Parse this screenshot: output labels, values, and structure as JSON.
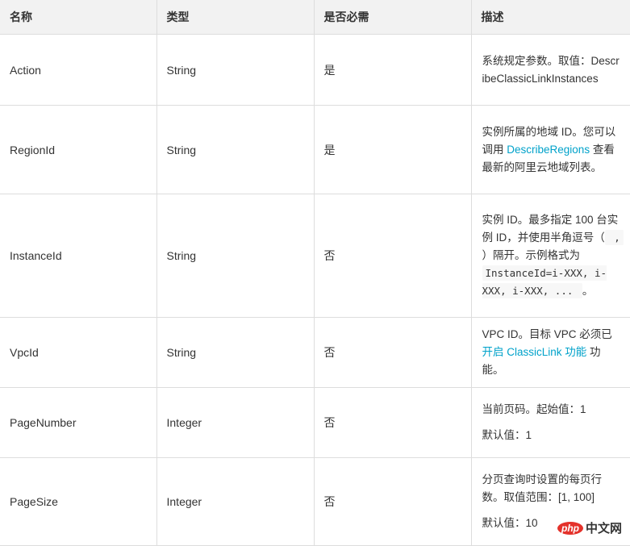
{
  "table": {
    "headers": [
      "名称",
      "类型",
      "是否必需",
      "描述"
    ],
    "rows": [
      {
        "name": "Action",
        "type": "String",
        "required": "是",
        "desc": {
          "text1": "系统规定参数。取值：DescribeClassicLinkInstances"
        }
      },
      {
        "name": "RegionId",
        "type": "String",
        "required": "是",
        "desc": {
          "before": "实例所属的地域 ID。您可以调用 ",
          "link": "DescribeRegions",
          "after": " 查看最新的阿里云地域列表。"
        }
      },
      {
        "name": "InstanceId",
        "type": "String",
        "required": "否",
        "desc": {
          "part1": "实例 ID。最多指定 100 台实例 ID，并使用半角逗号（",
          "code1": " , ",
          "part2": "）隔开。示例格式为 ",
          "code2": " InstanceId=i-XXX, i-XXX, i-XXX, ... ",
          "part3": "。"
        }
      },
      {
        "name": "VpcId",
        "type": "String",
        "required": "否",
        "desc": {
          "before": "VPC ID。目标 VPC 必须已",
          "link": "开启 ClassicLink 功能",
          "after": " 功能。"
        }
      },
      {
        "name": "PageNumber",
        "type": "Integer",
        "required": "否",
        "desc": {
          "line1": "当前页码。起始值：1",
          "line2": "默认值：1"
        }
      },
      {
        "name": "PageSize",
        "type": "Integer",
        "required": "否",
        "desc": {
          "line1": "分页查询时设置的每页行数。取值范围：[1, 100]",
          "line2": "默认值：10"
        }
      }
    ]
  },
  "watermark": {
    "logo": "php",
    "text": "中文网"
  },
  "colors": {
    "link": "#00a2ca",
    "header_bg": "#f2f2f2",
    "border": "#dddddd"
  }
}
